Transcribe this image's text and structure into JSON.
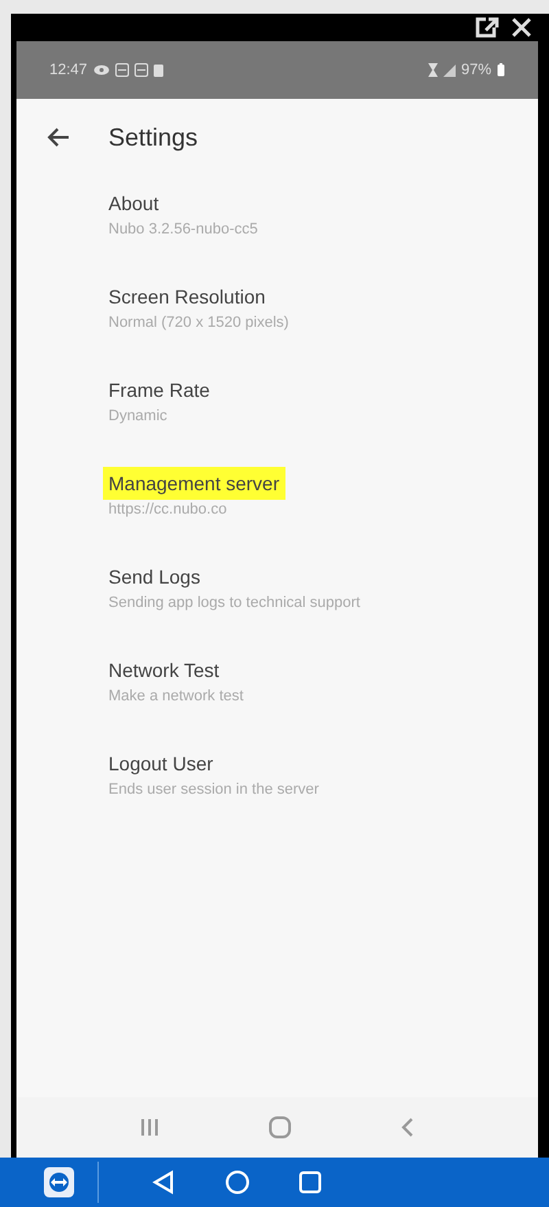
{
  "status_bar": {
    "time": "12:47",
    "battery": "97%"
  },
  "app_bar": {
    "title": "Settings"
  },
  "items": [
    {
      "title": "About",
      "subtitle": "Nubo 3.2.56-nubo-cc5",
      "highlighted": false
    },
    {
      "title": "Screen Resolution",
      "subtitle": "Normal (720 x 1520 pixels)",
      "highlighted": false
    },
    {
      "title": "Frame Rate",
      "subtitle": "Dynamic",
      "highlighted": false
    },
    {
      "title": "Management server",
      "subtitle": "https://cc.nubo.co",
      "highlighted": true
    },
    {
      "title": "Send Logs",
      "subtitle": "Sending app logs to technical support",
      "highlighted": false
    },
    {
      "title": "Network Test",
      "subtitle": "Make a network test",
      "highlighted": false
    },
    {
      "title": "Logout User",
      "subtitle": "Ends user session in the server",
      "highlighted": false
    }
  ]
}
